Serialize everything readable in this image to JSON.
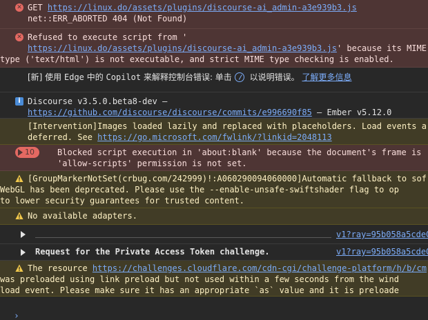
{
  "messages": {
    "err1": {
      "prefix": "GET ",
      "url": "https://linux.do/assets/plugins/discourse-ai_admin-a3e939b3.js",
      "line2": "net::ERR_ABORTED 404 (Not Found)"
    },
    "err2": {
      "prefix": "Refused to execute script from '",
      "url": "https://linux.do/assets/plugins/discourse-ai_admin-a3e939b3.js",
      "suffix": "' because its MIME",
      "line3": "type ('text/html') is not executable, and strict MIME type checking is enabled."
    },
    "copilot": {
      "text_before": "[新] 使用 ",
      "edge": "Edge",
      "mid": " 中的 ",
      "copilot": "Copilot",
      "text_after": " 来解释控制台错误: 单击",
      "text_end": " 以说明错误。",
      "link": "了解更多信息"
    },
    "info1": {
      "line1": "Discourse v3.5.0.beta8-dev —",
      "url": "https://github.com/discourse/discourse/commits/e996690f85",
      "line2_suffix": " — Ember v5.12.0"
    },
    "intervention": {
      "line1": "[Intervention]Images loaded lazily and replaced with placeholders. Load events a",
      "line2_prefix": "deferred. See ",
      "url": "https://go.microsoft.com/fwlink/?linkid=2048113"
    },
    "blocked": {
      "count": "10",
      "line1": "Blocked script execution in 'about:blank' because the document's frame is",
      "line2": "'allow-scripts' permission is not set."
    },
    "gpu": {
      "line1": "[GroupMarkerNotSet(crbug.com/242999)!:A060290094060000]Automatic fallback to sof",
      "line2": "WebGL has been deprecated. Please use the --enable-unsafe-swiftshader flag to op",
      "line3": "to lower security guarantees for trusted content."
    },
    "adapters": {
      "text": "No available adapters."
    },
    "collapsed1": {
      "label": "",
      "src": "v1?ray=95b058a5cde0"
    },
    "collapsed2": {
      "label": "Request for the Private Access Token challenge.",
      "src": "v1?ray=95b058a5cde0"
    },
    "resource": {
      "prefix": "The resource ",
      "url": "https://challenges.cloudflare.com/cdn-cgi/challenge-platform/h/b/cm",
      "line2": "was preloaded using link preload but not used within a few seconds from the wind",
      "line3": "load event. Please make sure it has an appropriate `as` value and it is preloade"
    }
  },
  "prompt_symbol": "›",
  "colors": {
    "error_bg": "#4e3534",
    "warning_bg": "#413c26",
    "link": "#7cacf8",
    "background": "#282828"
  }
}
